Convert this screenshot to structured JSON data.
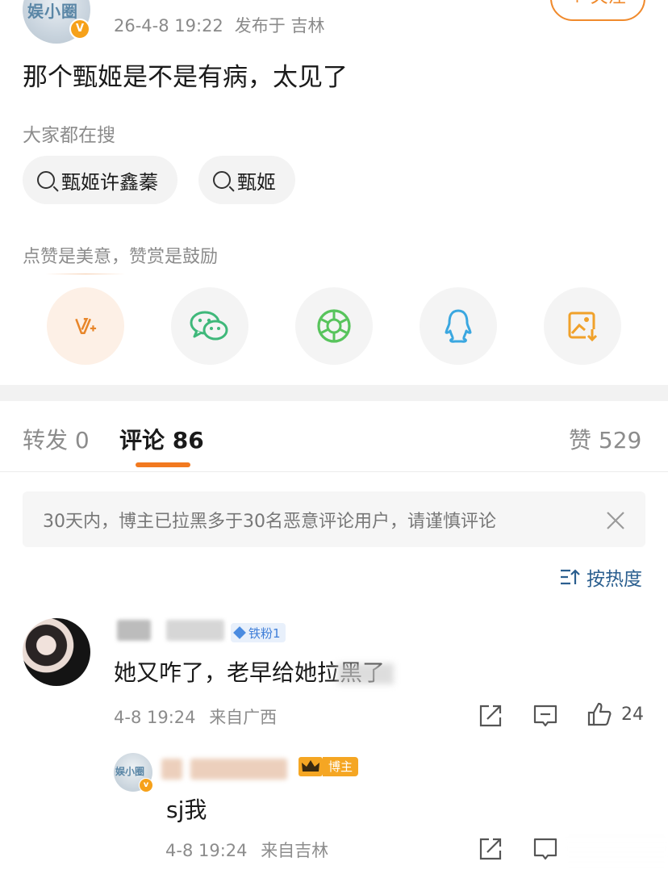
{
  "post": {
    "author_avatar_text": "娱小圈",
    "verified_mark": "V",
    "time": "26-4-8 19:22",
    "location": "发布于 吉林",
    "follow_label": "+ 关注",
    "text": "那个甄姬是不是有病，太见了"
  },
  "search": {
    "title": "大家都在搜",
    "chips": [
      "甄姬许鑫蓁",
      "甄姬"
    ]
  },
  "reward": {
    "text": "点赞是美意，赞赏是鼓励",
    "share_icons": [
      "weibo-reward-icon",
      "wechat-icon",
      "moments-icon",
      "qq-icon",
      "save-image-icon"
    ]
  },
  "tabs": {
    "repost": "转发 0",
    "comments": "评论 86",
    "likes": "赞 529"
  },
  "notice": {
    "text": "30天内，博主已拉黑多于30名恶意评论用户，请谨慎评论"
  },
  "sort": {
    "label": "按热度"
  },
  "comment": {
    "fan_badge": "铁粉1",
    "text": "她又咋了，老早给她拉黑了",
    "time": "4-8 19:24",
    "location": "来自广西",
    "likes": "24"
  },
  "reply": {
    "avatar_text": "娱小圈",
    "verified_mark": "v",
    "owner_badge": "博主",
    "text": "sj我",
    "time": "4-8 19:24",
    "location": "来自吉林"
  },
  "colors": {
    "accent": "#f2791f",
    "link": "#2b5f8f",
    "muted": "#8c8c8c"
  }
}
